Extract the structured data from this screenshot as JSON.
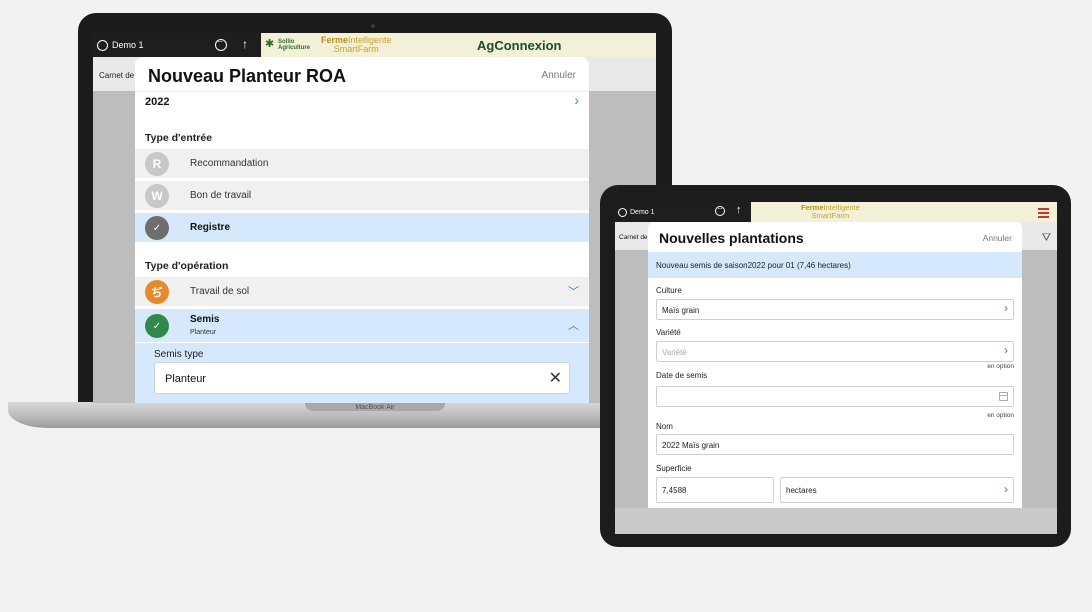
{
  "laptop": {
    "brand": "MacBook Air",
    "app_bar": {
      "user": "Demo 1",
      "logo_sollio_1": "Sollio",
      "logo_sollio_2": "Agriculture",
      "logo_ferme_1a": "Ferme",
      "logo_ferme_1b": "Intelligente",
      "logo_ferme_2": "SmartFarm",
      "logo_agc": "AgConnexion"
    },
    "carnet_label": "Carnet de",
    "modal": {
      "title": "Nouveau Planteur ROA",
      "cancel": "Annuler",
      "year": "2022",
      "section_entry": "Type d'entrée",
      "entry_options": [
        {
          "badge": "R",
          "label": "Recommandation"
        },
        {
          "badge": "W",
          "label": "Bon de travail"
        },
        {
          "badge": "✓",
          "label": "Registre"
        }
      ],
      "section_operation": "Type d'opération",
      "operation_options": [
        {
          "label": "Travail de sol",
          "sub": ""
        },
        {
          "label": "Semis",
          "sub": "Planteur"
        }
      ],
      "semis_type_label": "Semis type",
      "semis_type_value": "Planteur"
    }
  },
  "tablet": {
    "app_bar": {
      "user": "Demo 1",
      "logo_ferme_1a": "Ferme",
      "logo_ferme_1b": "Intelligente",
      "logo_ferme_2": "SmartFarm"
    },
    "carnet_label": "Carnet de",
    "modal": {
      "title": "Nouvelles plantations",
      "cancel": "Annuler",
      "banner": "Nouveau semis de saison2022 pour 01 (7,46 hectares)",
      "culture_label": "Culture",
      "culture_value": "Maïs grain",
      "variete_label": "Variété",
      "variete_placeholder": "Variété",
      "optional_1": "en option",
      "date_label": "Date de semis",
      "optional_2": "en option",
      "nom_label": "Nom",
      "nom_value": "2022 Maïs grain",
      "superficie_label": "Superficie",
      "superficie_value": "7,4588",
      "unit_value": "hectares"
    }
  },
  "colors": {
    "accent_blue": "#3a7bd5",
    "selected_row": "#d6e8fb",
    "badge_grey": "#c8c8c8",
    "badge_dark": "#6e6e6e",
    "badge_orange": "#e58a2d",
    "badge_green": "#2f8a4a",
    "menu_red": "#c0392b"
  }
}
